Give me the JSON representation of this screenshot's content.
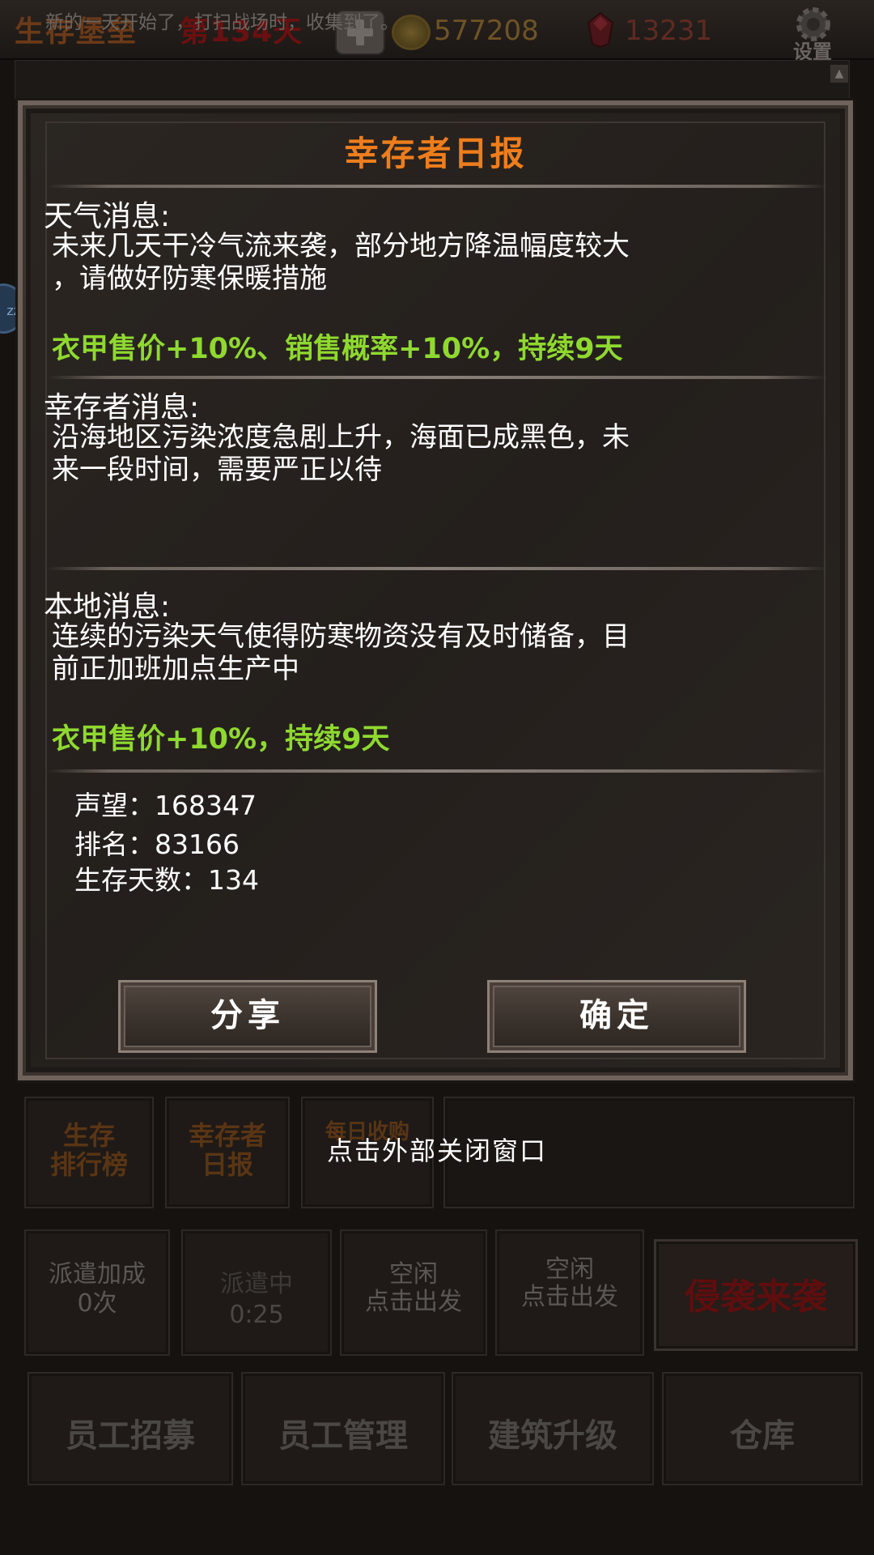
{
  "topbar": {
    "game_title": "生存堡垒",
    "day": "第134天",
    "coins": "577208",
    "gems": "13231",
    "settings": "设置"
  },
  "log": {
    "text": "新的一天开始了，打扫战场时，收集到了。"
  },
  "dialog": {
    "title": "幸存者日报",
    "weather": {
      "heading": "天气消息:",
      "line1": "未来几天干冷气流来袭，部分地方降温幅度较大",
      "line2": "，请做好防寒保暖措施",
      "effect": "衣甲售价+10%、销售概率+10%，持续9天"
    },
    "survivor": {
      "heading": "幸存者消息:",
      "line1": "沿海地区污染浓度急剧上升，海面已成黑色，未",
      "line2": "来一段时间，需要严正以待"
    },
    "local": {
      "heading": "本地消息:",
      "line1": "连续的污染天气使得防寒物资没有及时储备，目",
      "line2": "前正加班加点生产中",
      "effect": "衣甲售价+10%，持续9天"
    },
    "stats": {
      "reputation": "声望：168347",
      "rank": "排名：83166",
      "days": "生存天数：134"
    },
    "share_label": "分享",
    "confirm_label": "确定"
  },
  "close_hint": "点击外部关闭窗口",
  "tabs": {
    "ranking_l1": "生存",
    "ranking_l2": "排行榜",
    "daily_l1": "幸存者",
    "daily_l2": "日报",
    "income": "每日收购"
  },
  "dispatch": {
    "bonus_l1": "派遣加成",
    "bonus_l2": "0次",
    "busy_l1": "派遣中",
    "busy_l2": "0:25",
    "idle1_l1": "空闲",
    "idle1_l2": "点击出发",
    "idle2_l1": "空闲",
    "idle2_l2": "点击出发",
    "invasion": "侵袭来袭"
  },
  "bottom": {
    "recruit": "员工招募",
    "manage": "员工管理",
    "upgrade": "建筑升级",
    "warehouse": "仓库"
  },
  "icons": {
    "plus": "plus-icon",
    "coin": "coin-icon",
    "gem": "gem-icon",
    "settings": "gear-icon"
  },
  "colors": {
    "title_orange": "#ee7d1c",
    "effect_green": "#8fd92f",
    "invasion_red": "#5e0e0e"
  }
}
